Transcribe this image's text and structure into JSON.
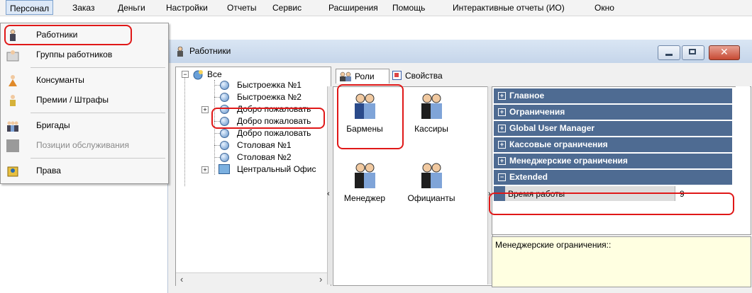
{
  "menubar": {
    "items": [
      "Персонал",
      "Заказ",
      "Деньги",
      "Настройки",
      "Отчеты",
      "Сервис",
      "Расширения",
      "Помощь",
      "Интерактивные отчеты (ИО)",
      "Окно"
    ]
  },
  "dropdown": {
    "items": [
      {
        "label": "Работники",
        "icon": "worker-icon",
        "highlighted": true
      },
      {
        "label": "Группы работников",
        "icon": "worker-groups-icon"
      },
      {
        "label": "Консуманты",
        "icon": "consumer-icon"
      },
      {
        "label": "Премии / Штрафы",
        "icon": "bonus-penalty-icon"
      },
      {
        "label": "Бригады",
        "icon": "brigades-icon"
      },
      {
        "label": "Позиции обслуживания",
        "icon": "service-positions-icon",
        "disabled": true
      },
      {
        "label": "Права",
        "icon": "rights-icon"
      }
    ]
  },
  "window": {
    "title": "Работники",
    "tree": {
      "root": "Все",
      "nodes": [
        "Быстроежка №1",
        "Быстроежка №2",
        "Добро пожаловать",
        "Добро пожаловать",
        "Добро пожаловать",
        "Столовая №1",
        "Столовая №2",
        "Центральный Офис"
      ]
    },
    "tabs": [
      "Роли",
      "Свойства"
    ],
    "roles": [
      "Бармены",
      "Кассиры",
      "Менеджер",
      "Официанты"
    ],
    "properties": {
      "categories": [
        "Главное",
        "Ограничения",
        "Global User Manager",
        "Кассовые ограничения",
        "Менеджерские ограничения",
        "Extended"
      ],
      "expanded_row": {
        "name": "Время работы",
        "value": "9"
      }
    },
    "description": "Менеджерские ограничения::"
  },
  "colors": {
    "highlight": "#e01818",
    "category_bg": "#4e6b92",
    "desc_bg": "#ffffe1"
  }
}
